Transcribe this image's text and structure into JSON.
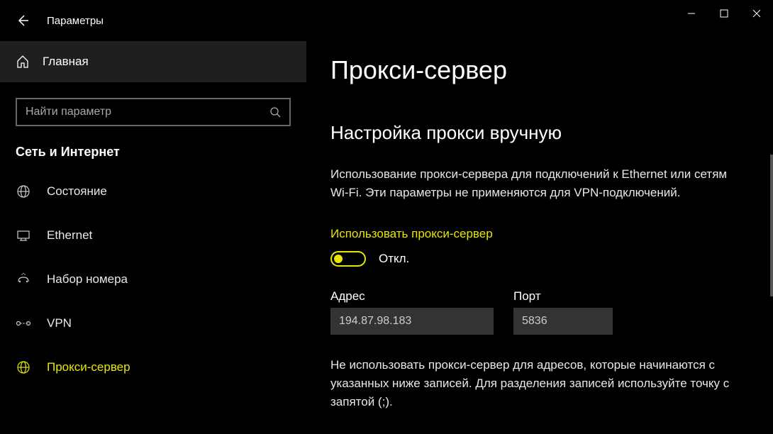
{
  "app_title": "Параметры",
  "sidebar": {
    "home": "Главная",
    "search_placeholder": "Найти параметр",
    "category": "Сеть и Интернет",
    "items": [
      {
        "label": "Состояние"
      },
      {
        "label": "Ethernet"
      },
      {
        "label": "Набор номера"
      },
      {
        "label": "VPN"
      },
      {
        "label": "Прокси-сервер"
      }
    ]
  },
  "page": {
    "title": "Прокси-сервер",
    "section_title": "Настройка прокси вручную",
    "description": "Использование прокси-сервера для подключений к Ethernet или сетям Wi-Fi. Эти параметры не применяются для VPN-подключений.",
    "toggle_label": "Использовать прокси-сервер",
    "toggle_state": "Откл.",
    "address_label": "Адрес",
    "address_value": "194.87.98.183",
    "port_label": "Порт",
    "port_value": "5836",
    "exclude_desc": "Не использовать прокси-сервер для адресов, которые начинаются с указанных ниже записей. Для разделения записей используйте точку с запятой (;)."
  },
  "accent_color": "#e6e600"
}
